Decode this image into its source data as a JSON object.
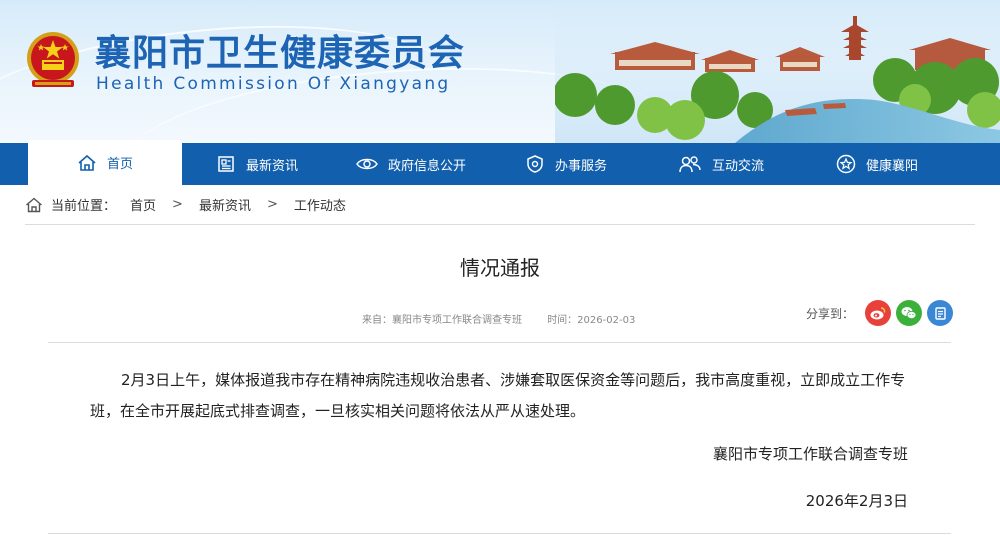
{
  "header": {
    "title_cn": "襄阳市卫生健康委员会",
    "title_en": "Health Commission Of Xiangyang"
  },
  "nav": {
    "items": [
      {
        "label": "首页",
        "icon": "home-icon"
      },
      {
        "label": "最新资讯",
        "icon": "news-icon"
      },
      {
        "label": "政府信息公开",
        "icon": "eye-icon"
      },
      {
        "label": "办事服务",
        "icon": "shield-icon"
      },
      {
        "label": "互动交流",
        "icon": "people-icon"
      },
      {
        "label": "健康襄阳",
        "icon": "star-icon"
      }
    ]
  },
  "breadcrumb": {
    "prefix": "当前位置：",
    "items": [
      "首页",
      "最新资讯",
      "工作动态"
    ],
    "separator": ">"
  },
  "article": {
    "title": "情况通报",
    "source": "来自：襄阳市专项工作联合调查专班",
    "time": "时间：2026-02-03",
    "share_label": "分享到：",
    "share_targets": [
      "weibo-icon",
      "wechat-icon",
      "qzone-icon"
    ],
    "body": "2月3日上午，媒体报道我市存在精神病院违规收治患者、涉嫌套取医保资金等问题后，我市高度重视，立即成立工作专班，在全市开展起底式排查调查，一旦核实相关问题将依法从严从速处理。",
    "signature": "襄阳市专项工作联合调查专班",
    "date": "2026年2月3日"
  },
  "colors": {
    "nav_bg": "#1260ad",
    "title_blue": "#1d64b4",
    "weibo": "#e8413b",
    "wechat": "#3bb03a",
    "qzone": "#3a87d6"
  }
}
